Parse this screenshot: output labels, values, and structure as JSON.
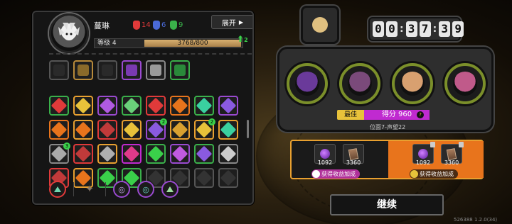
{
  "character": {
    "name": "蔓琳",
    "level_label": "等级 4",
    "xp_current": 3768,
    "xp_max": 800,
    "xp_text": "3768/800",
    "level_up_indicator": "2",
    "ranks": [
      {
        "icon": "red-mask-icon",
        "value": "14",
        "color": "#e03a3a"
      },
      {
        "icon": "blue-mask-icon",
        "value": "6",
        "color": "#4a6ad8"
      },
      {
        "icon": "green-mask-icon",
        "value": "9",
        "color": "#3ab04a"
      }
    ]
  },
  "expand_button": {
    "label": "展开"
  },
  "relics": [
    {
      "name": "relic-empty",
      "border": "#555",
      "fill": "#2a2a2a"
    },
    {
      "name": "relic-gold-mask",
      "border": "#b88a3a",
      "fill": "#8a6a2a"
    },
    {
      "name": "relic-empty",
      "border": "#555",
      "fill": "#2a2a2a"
    },
    {
      "name": "relic-purple-scythe",
      "border": "#9a4ad0",
      "fill": "#7a3ab0"
    },
    {
      "name": "relic-silver-bag",
      "border": "#888",
      "fill": "#9a9a9a"
    },
    {
      "name": "relic-green-leaf",
      "border": "#3ab04a",
      "fill": "#2a8a3a"
    }
  ],
  "skills": [
    {
      "border": "#3ab04a",
      "fill": "#e03a3a"
    },
    {
      "border": "#e8a030",
      "fill": "#e8c23a"
    },
    {
      "border": "#9a4ad0",
      "fill": "#b05ae0"
    },
    {
      "border": "#3ab04a",
      "fill": "#6ad07a"
    },
    {
      "border": "#e03a3a",
      "fill": "#e03a3a"
    },
    {
      "border": "#e8741c",
      "fill": "#e8741c"
    },
    {
      "border": "#3ab04a",
      "fill": "#3ad0a0"
    },
    {
      "border": "#9a4ad0",
      "fill": "#8a5ae0"
    },
    {
      "border": "#e8741c",
      "fill": "#e8741c"
    },
    {
      "border": "#e8a030",
      "fill": "#e8741c"
    },
    {
      "border": "#e03a3a",
      "fill": "#c03a3a"
    },
    {
      "border": "#e8a030",
      "fill": "#e8c23a"
    },
    {
      "border": "#9a4ad0",
      "fill": "#8a5ae0",
      "badge": "2"
    },
    {
      "border": "#e8a030",
      "fill": "#d8a030"
    },
    {
      "border": "#e8a030",
      "fill": "#e8c23a",
      "badge": "2"
    },
    {
      "border": "#e8a030",
      "fill": "#3ad0a0"
    },
    {
      "border": "#888",
      "fill": "#aaaaaa",
      "badge": "3"
    },
    {
      "border": "#e03a3a",
      "fill": "#c03a3a"
    },
    {
      "border": "#e8a030",
      "fill": "#b0b0b0"
    },
    {
      "border": "#c02ad0",
      "fill": "#e03a8a"
    },
    {
      "border": "#3ab04a",
      "fill": "#3ad04a"
    },
    {
      "border": "#9a4ad0",
      "fill": "#c05ae0"
    },
    {
      "border": "#3ab04a",
      "fill": "#8a5ae0"
    },
    {
      "border": "#888",
      "fill": "#cccccc"
    },
    {
      "border": "#e03a3a",
      "fill": "#c03a3a"
    },
    {
      "border": "#e8a030",
      "fill": "#e8741c"
    },
    {
      "border": "#3ab04a",
      "fill": "#3ad04a"
    },
    {
      "border": "#3ab04a",
      "fill": "#3ad04a"
    },
    {
      "border": "#555",
      "fill": "#333333"
    },
    {
      "border": "#555",
      "fill": "#333333"
    },
    {
      "border": "#555",
      "fill": "#333333"
    },
    {
      "border": "#555",
      "fill": "#333333"
    }
  ],
  "timer": {
    "digits": [
      "0",
      "0",
      "3",
      "7",
      "3",
      "9"
    ]
  },
  "team": [
    {
      "name": "hero-purple-hood",
      "face": "#6a3a9a"
    },
    {
      "name": "hero-crowned-mask",
      "face": "#7a4a7a"
    },
    {
      "name": "hero-glasses",
      "face": "#d8a070"
    },
    {
      "name": "hero-pink-blossom",
      "face": "#c05a8a"
    }
  ],
  "score": {
    "best_label": "最佳",
    "score_text": "得分 960",
    "info": "?",
    "position_text": "位面7-声望22"
  },
  "rewards": {
    "left_orb": "1092",
    "left_card": "3360",
    "left_tag": "获得收益加成",
    "right_orb": "1092",
    "right_card": "3360",
    "right_tag": "获得收益加成"
  },
  "continue_button": {
    "label": "继续"
  },
  "version": "526388 1.2.0(34)"
}
